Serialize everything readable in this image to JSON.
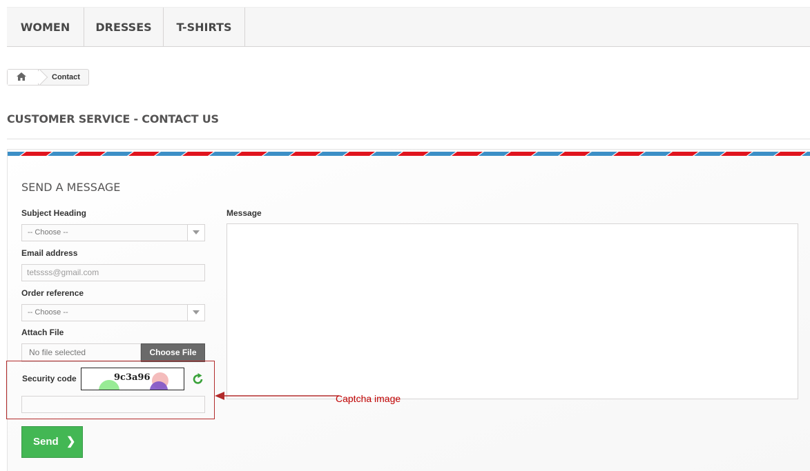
{
  "nav": {
    "items": [
      {
        "label": "WOMEN"
      },
      {
        "label": "DRESSES"
      },
      {
        "label": "T-SHIRTS"
      }
    ]
  },
  "breadcrumb": {
    "home_icon": "home-icon",
    "current": "Contact"
  },
  "page": {
    "heading": "CUSTOMER SERVICE - CONTACT US"
  },
  "form": {
    "title": "SEND A MESSAGE",
    "subject_label": "Subject Heading",
    "subject_value": "-- Choose --",
    "email_label": "Email address",
    "email_value": "tetssss@gmail.com",
    "order_label": "Order reference",
    "order_value": "-- Choose --",
    "attach_label": "Attach File",
    "file_placeholder": "No file selected",
    "file_button": "Choose File",
    "security_label": "Security code",
    "captcha_text": "9c3a96",
    "refresh_icon": "refresh-icon",
    "message_label": "Message",
    "send_label": "Send",
    "send_icon": "chevron-right-icon"
  },
  "annotation": {
    "label": "Captcha image",
    "color": "#c00000"
  },
  "colors": {
    "send": "#43b754",
    "airmail_red": "#e0141e",
    "airmail_blue": "#3c8fc6"
  }
}
